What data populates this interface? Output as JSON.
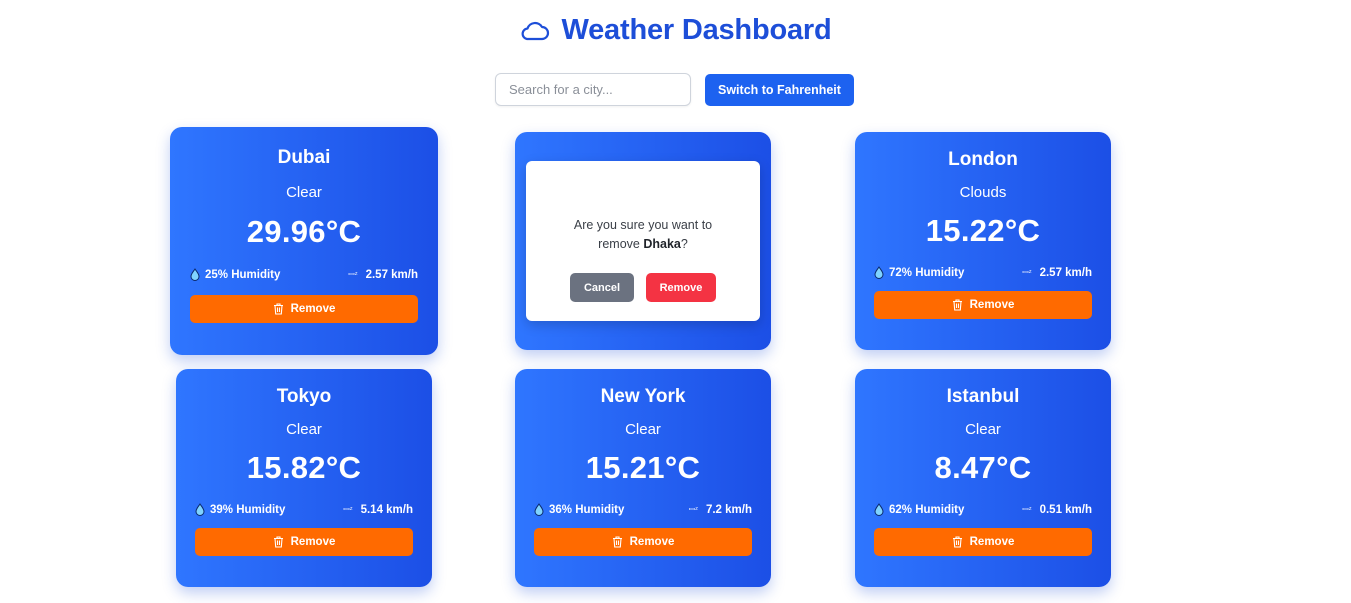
{
  "header": {
    "title": "Weather Dashboard",
    "icon": "cloud-icon"
  },
  "search": {
    "placeholder": "Search for a city...",
    "value": ""
  },
  "unit_toggle_label": "Switch to Fahrenheit",
  "colors": {
    "accent": "#1d4ed8",
    "card_start": "#2f76ff",
    "card_end": "#1c4fe6",
    "remove": "#ff6a00",
    "danger": "#f43343",
    "cancel": "#6b7280"
  },
  "cards": [
    {
      "city": "Dubai",
      "condition": "Clear",
      "temp": "29.96°C",
      "humidity": "25% Humidity",
      "wind": "2.57 km/h",
      "remove_label": "Remove"
    },
    {
      "city": "Dhaka"
    },
    {
      "city": "London",
      "condition": "Clouds",
      "temp": "15.22°C",
      "humidity": "72% Humidity",
      "wind": "2.57 km/h",
      "remove_label": "Remove"
    },
    {
      "city": "Tokyo",
      "condition": "Clear",
      "temp": "15.82°C",
      "humidity": "39% Humidity",
      "wind": "5.14 km/h",
      "remove_label": "Remove"
    },
    {
      "city": "New York",
      "condition": "Clear",
      "temp": "15.21°C",
      "humidity": "36% Humidity",
      "wind": "7.2 km/h",
      "remove_label": "Remove"
    },
    {
      "city": "Istanbul",
      "condition": "Clear",
      "temp": "8.47°C",
      "humidity": "62% Humidity",
      "wind": "0.51 km/h",
      "remove_label": "Remove"
    }
  ],
  "modal": {
    "text_before": "Are you sure you want to remove ",
    "city": "Dhaka",
    "text_after": "?",
    "cancel_label": "Cancel",
    "remove_label": "Remove"
  },
  "wind_icon_glyph": "ꟷᶻ"
}
